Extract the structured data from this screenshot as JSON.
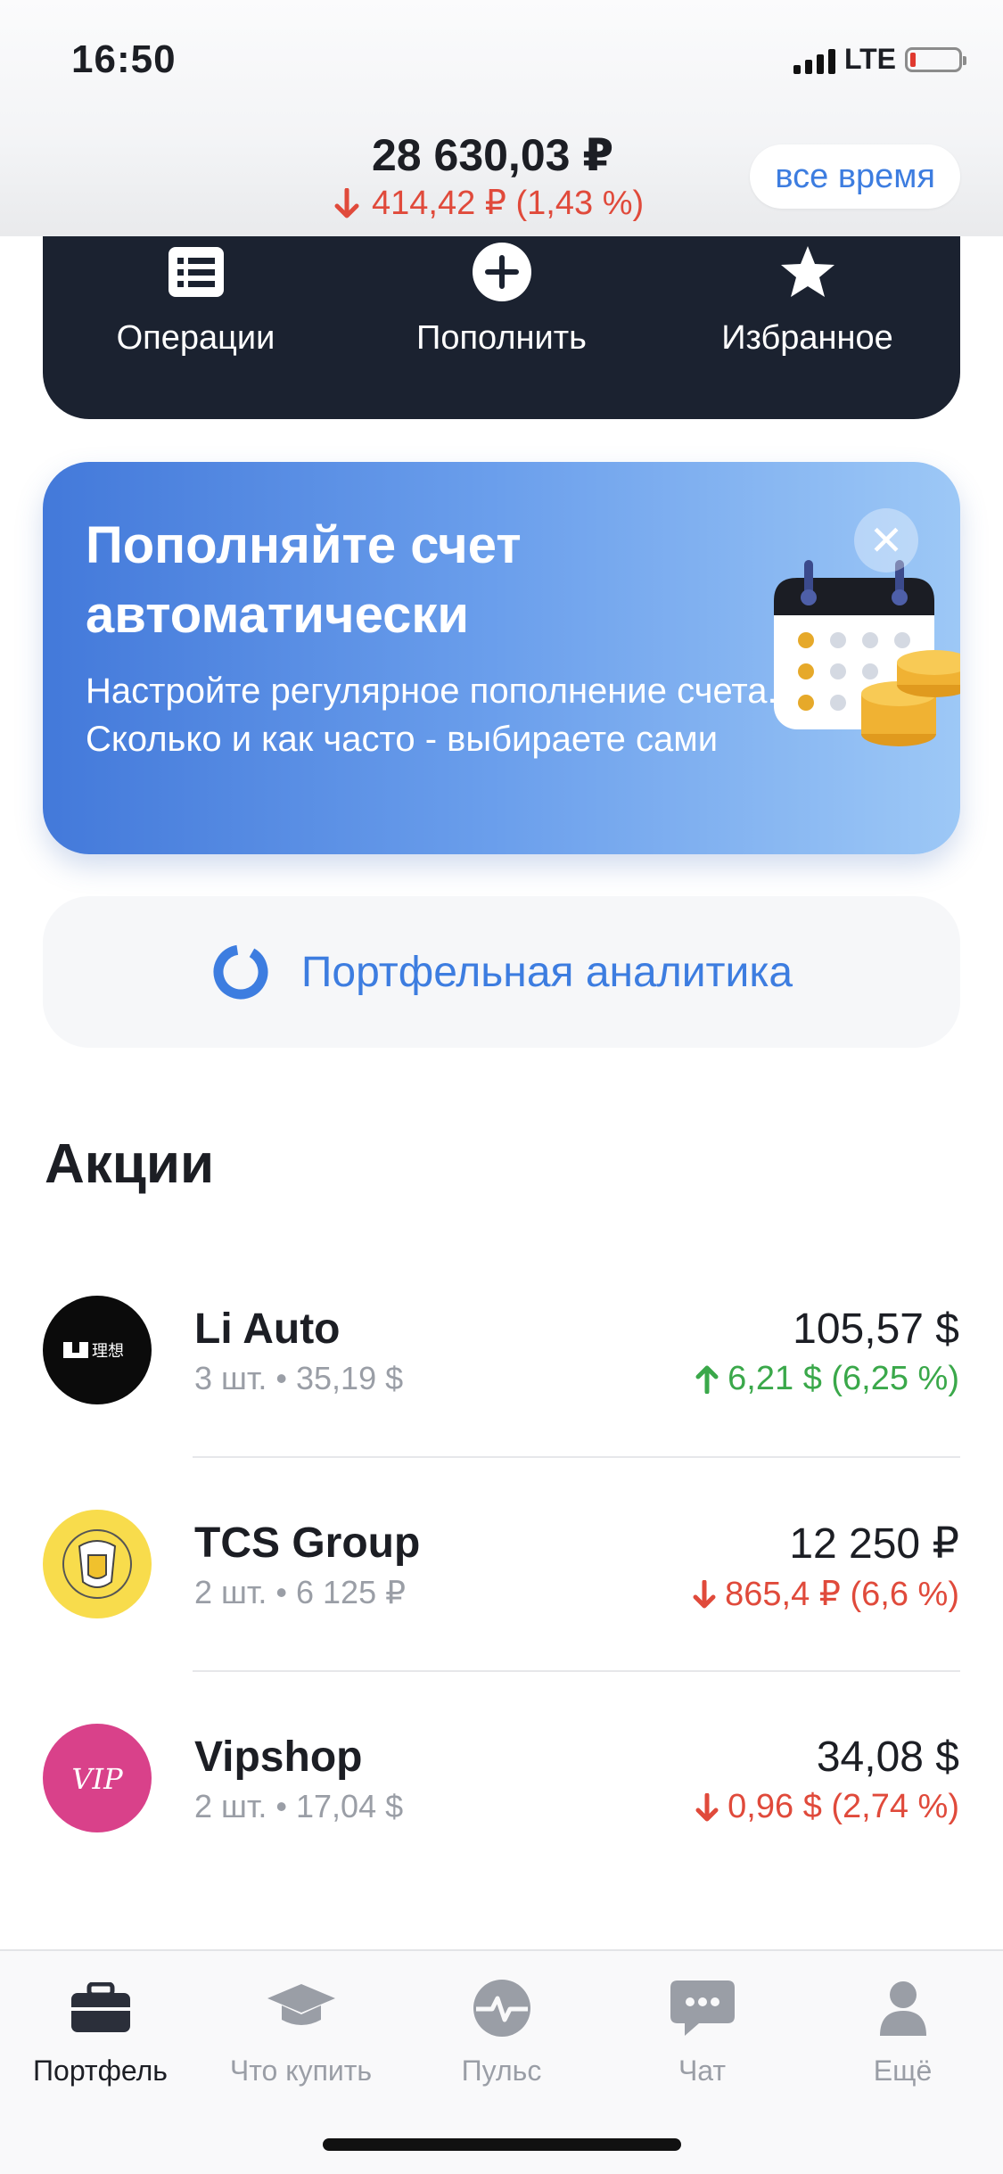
{
  "status_bar": {
    "time": "16:50",
    "network": "LTE"
  },
  "header": {
    "total": "28 630,03 ₽",
    "change": "414,42 ₽ (1,43 %)",
    "period_button": "все время"
  },
  "actions": [
    {
      "label": "Операции",
      "icon": "list-icon"
    },
    {
      "label": "Пополнить",
      "icon": "plus-circle-icon"
    },
    {
      "label": "Избранное",
      "icon": "star-icon"
    }
  ],
  "promo": {
    "title": "Пополняйте счет автоматически",
    "text": "Настройте регулярное пополнение счета. Сколько и как часто - выбираете сами"
  },
  "analytics": {
    "label": "Портфельная аналитика"
  },
  "stocks_section": {
    "title": "Акции",
    "items": [
      {
        "name": "Li Auto",
        "qty": "3 шт.",
        "unit_price": "35,19 $",
        "price": "105,57 $",
        "change": "6,21 $ (6,25 %)",
        "direction": "up",
        "logo_text": "理想"
      },
      {
        "name": "TCS Group",
        "qty": "2 шт.",
        "unit_price": "6 125 ₽",
        "price": "12 250 ₽",
        "change": "865,4 ₽ (6,6 %)",
        "direction": "down"
      },
      {
        "name": "Vipshop",
        "qty": "2 шт.",
        "unit_price": "17,04 $",
        "price": "34,08 $",
        "change": "0,96 $ (2,74 %)",
        "direction": "down",
        "logo_text": "VIP"
      }
    ]
  },
  "tabbar": [
    {
      "label": "Портфель",
      "icon": "briefcase-icon",
      "active": true
    },
    {
      "label": "Что купить",
      "icon": "graduation-cap-icon",
      "active": false
    },
    {
      "label": "Пульс",
      "icon": "pulse-icon",
      "active": false
    },
    {
      "label": "Чат",
      "icon": "chat-icon",
      "active": false
    },
    {
      "label": "Ещё",
      "icon": "profile-icon",
      "active": false
    }
  ],
  "colors": {
    "accent": "#3d7de0",
    "up": "#3aa84a",
    "down": "#e04a3b",
    "card_dark": "#1b2230"
  }
}
